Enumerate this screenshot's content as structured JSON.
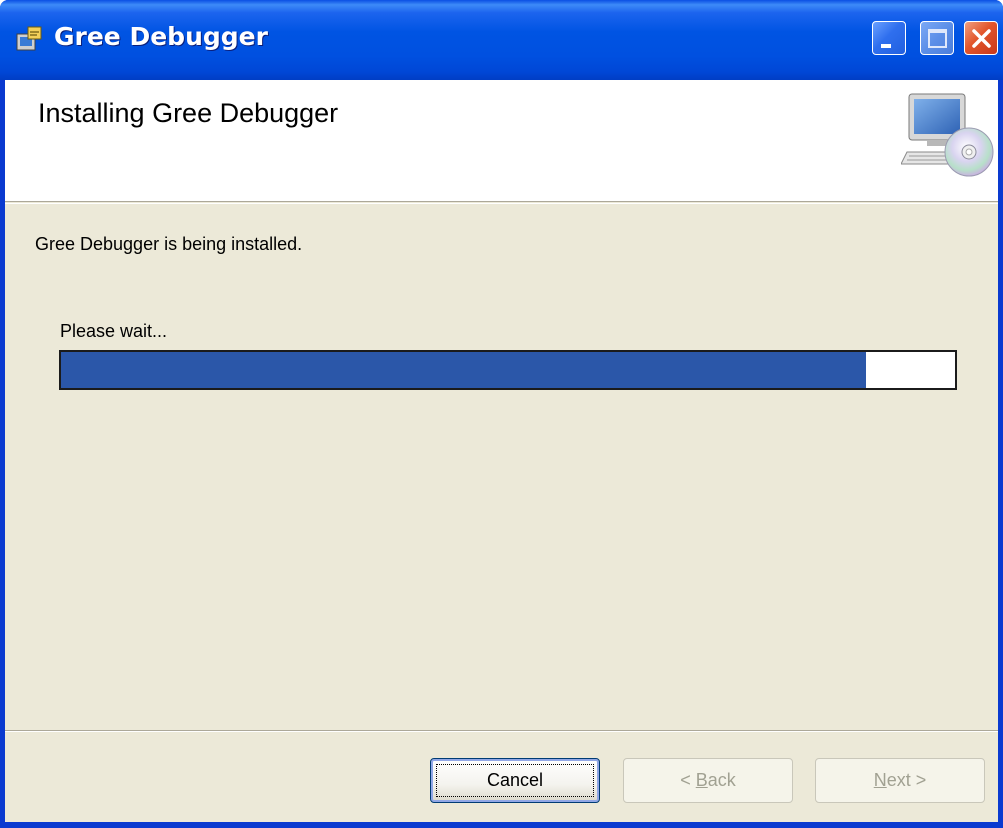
{
  "window": {
    "title": "Gree Debugger"
  },
  "banner": {
    "heading": "Installing Gree Debugger"
  },
  "main": {
    "status": "Gree Debugger is being installed.",
    "progress_label": "Please wait...",
    "progress_fraction": 0.9
  },
  "buttons": {
    "cancel": "Cancel",
    "back_pre": "< ",
    "back_key": "B",
    "back_post": "ack",
    "next_key": "N",
    "next_post": "ext >"
  },
  "colors": {
    "titlebar": "#0054e3",
    "progress_fill": "#2b57a9",
    "dialog_bg": "#ece9d8",
    "disabled_text": "#a1a192"
  },
  "icons": {
    "app": "installer-icon",
    "banner": "computer-cd-icon",
    "minimize": "minimize-icon",
    "maximize": "maximize-icon",
    "close": "close-icon"
  }
}
